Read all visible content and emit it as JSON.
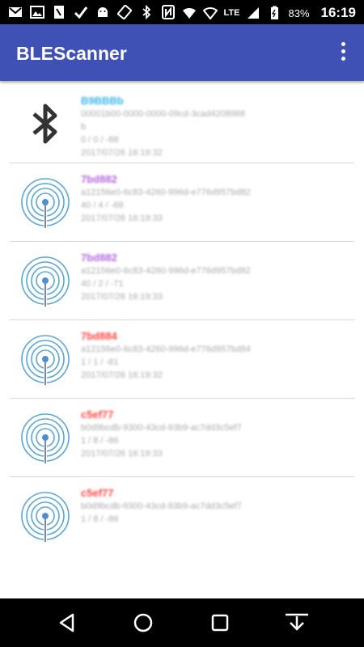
{
  "status_bar": {
    "battery": "83%",
    "time": "16:19",
    "network": "LTE"
  },
  "app_bar": {
    "title": "BLEScanner"
  },
  "colors": {
    "primary": "#3f51b5",
    "blue_name": "#33b5e5",
    "purple_name": "#b366e0",
    "red_name": "#ff4444"
  },
  "devices": [
    {
      "icon": "bluetooth-icon",
      "name": "B9BBBb",
      "name_color": "#33b5e5",
      "line1": "00001b00-0000-0000-09cd-3cad4208988",
      "line2": "b",
      "line3": "0 / 0 / -88",
      "line4": "2017/07/26 16:19:32"
    },
    {
      "icon": "ibeacon-icon",
      "name": "7bd882",
      "name_color": "#b366e0",
      "line1": "a12156e0-6c83-4260-996d-e776d957bd82",
      "line2": "40 / 4 / -68",
      "line3": "2017/07/26 16:19:33",
      "line4": ""
    },
    {
      "icon": "ibeacon-icon",
      "name": "7bd882",
      "name_color": "#b366e0",
      "line1": "a12156e0-6c83-4260-996d-e776d957bd82",
      "line2": "40 / 2 / -71",
      "line3": "2017/07/26 16:19:33",
      "line4": ""
    },
    {
      "icon": "ibeacon-icon",
      "name": "7bd884",
      "name_color": "#ff4444",
      "line1": "a12156e0-6c83-4260-996d-e776d957bd84",
      "line2": "1 / 1 / -81",
      "line3": "2017/07/26 16:19:32",
      "line4": ""
    },
    {
      "icon": "ibeacon-icon",
      "name": "c5ef77",
      "name_color": "#ff4444",
      "line1": "b0d9bcdb-9300-43cd-93b9-ac7dd3c5ef7",
      "line2": "1 / 8 / -86",
      "line3": "2017/07/26 16:19:33",
      "line4": ""
    },
    {
      "icon": "ibeacon-icon",
      "name": "c5ef77",
      "name_color": "#ff4444",
      "line1": "b0d9bcdb-9300-43cd-93b9-ac7dd3c5ef7",
      "line2": "1 / 8 / -86",
      "line3": "",
      "line4": ""
    }
  ]
}
